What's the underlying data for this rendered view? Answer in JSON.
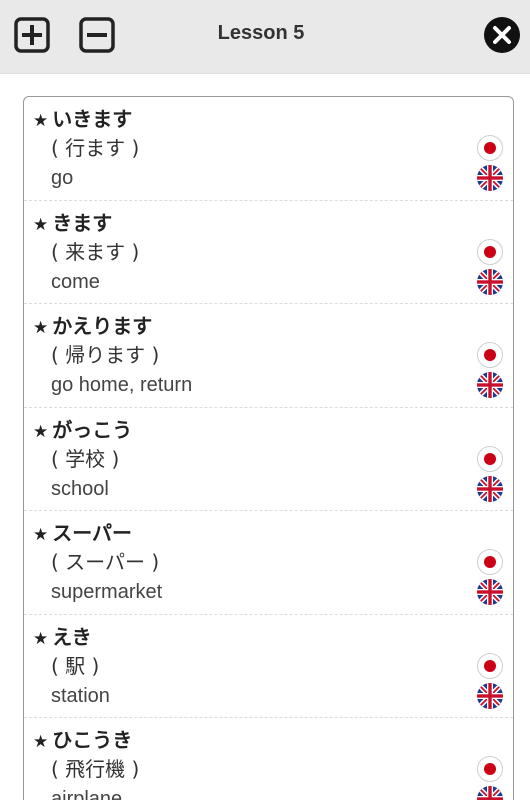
{
  "header": {
    "title": "Lesson 5",
    "icons": {
      "plus": "plus-square-icon",
      "minus": "minus-square-icon",
      "close": "close-circle-icon"
    }
  },
  "colors": {
    "header_bg": "#e9e9e9",
    "jp_red": "#cc0014",
    "uk_blue": "#1f3a8a",
    "uk_red": "#c8102e"
  },
  "star": "★",
  "items": [
    {
      "word": "いきます",
      "kanji": "( 行ます )",
      "meaning": "go"
    },
    {
      "word": "きます",
      "kanji": "( 来ます )",
      "meaning": "come"
    },
    {
      "word": "かえります",
      "kanji": "( 帰ります )",
      "meaning": "go home, return"
    },
    {
      "word": "がっこう",
      "kanji": "( 学校 )",
      "meaning": "school"
    },
    {
      "word": "スーパー",
      "kanji": "( スーパー )",
      "meaning": "supermarket"
    },
    {
      "word": "えき",
      "kanji": "( 駅 )",
      "meaning": "station"
    },
    {
      "word": "ひこうき",
      "kanji": "( 飛行機 )",
      "meaning": "airplane"
    }
  ]
}
